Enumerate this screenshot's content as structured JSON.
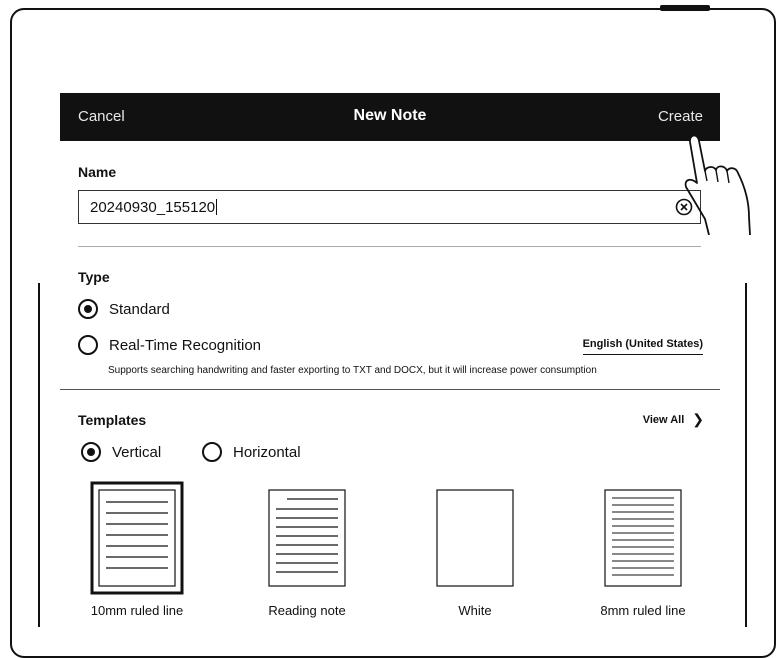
{
  "dialog": {
    "cancel_label": "Cancel",
    "title": "New Note",
    "create_label": "Create"
  },
  "name_section": {
    "label": "Name",
    "value": "20240930_155120"
  },
  "type_section": {
    "label": "Type",
    "options": [
      {
        "label": "Standard",
        "selected": true
      },
      {
        "label": "Real-Time Recognition",
        "selected": false
      }
    ],
    "language": "English (United States)",
    "description": "Supports searching handwriting and faster exporting to TXT and DOCX, but it will increase power consumption"
  },
  "templates_section": {
    "label": "Templates",
    "view_all_label": "View All",
    "orientations": [
      {
        "label": "Vertical",
        "selected": true
      },
      {
        "label": "Horizontal",
        "selected": false
      }
    ],
    "items": [
      {
        "label": "10mm ruled line",
        "selected": true,
        "icon": "ruled-line-paper-icon"
      },
      {
        "label": "Reading note",
        "selected": false,
        "icon": "reading-note-paper-icon"
      },
      {
        "label": "White",
        "selected": false,
        "icon": "blank-paper-icon"
      },
      {
        "label": "8mm ruled line",
        "selected": false,
        "icon": "dense-ruled-paper-icon"
      }
    ]
  },
  "icons": {
    "clear": "clear-x-icon",
    "chevron": "chevron-right-icon",
    "pointer": "tapping-hand-icon"
  }
}
